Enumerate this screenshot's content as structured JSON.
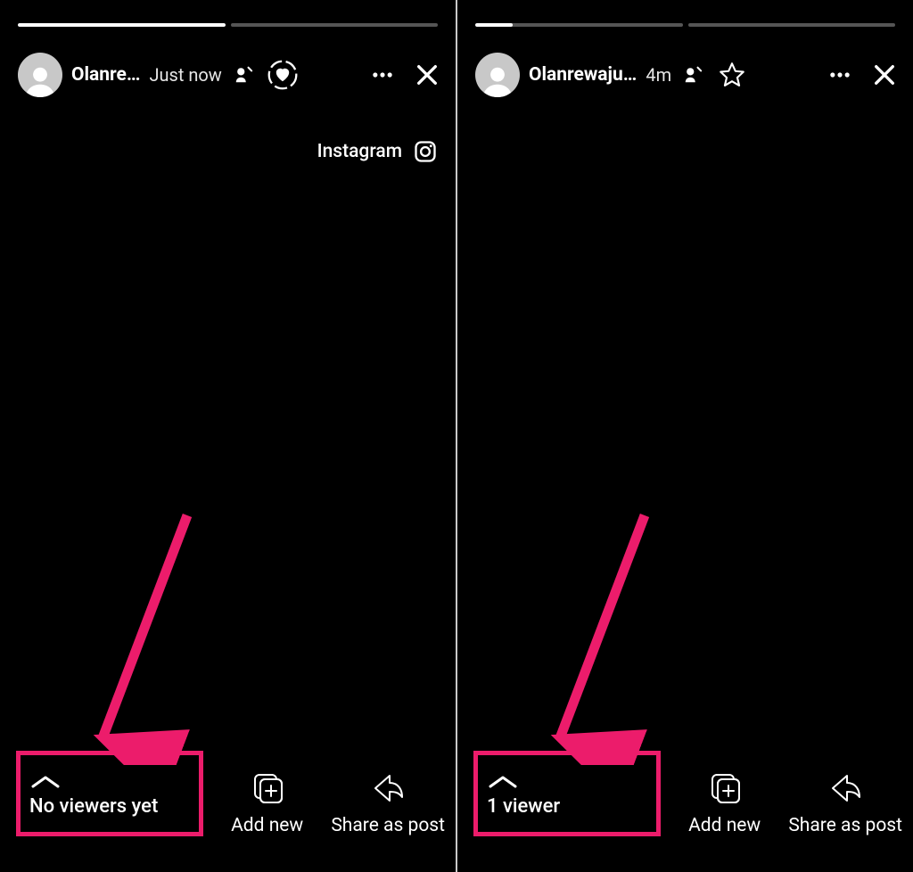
{
  "panes": [
    {
      "username": "Olanre…",
      "timestamp": "Just now",
      "badge_label": "Instagram",
      "viewers_label": "No viewers yet",
      "add_new_label": "Add new",
      "share_label": "Share as post",
      "progress_seg1_pct": 100,
      "progress_seg2_pct": 0,
      "header_star_style": "heart_circle"
    },
    {
      "username": "Olanrewaju…",
      "timestamp": "4m",
      "viewers_label": "1 viewer",
      "add_new_label": "Add new",
      "share_label": "Share as post",
      "progress_seg1_pct": 18,
      "progress_seg2_pct": 0,
      "header_star_style": "star"
    }
  ],
  "annotation": {
    "color": "#ec1c6b",
    "type": "arrow_to_viewers"
  }
}
